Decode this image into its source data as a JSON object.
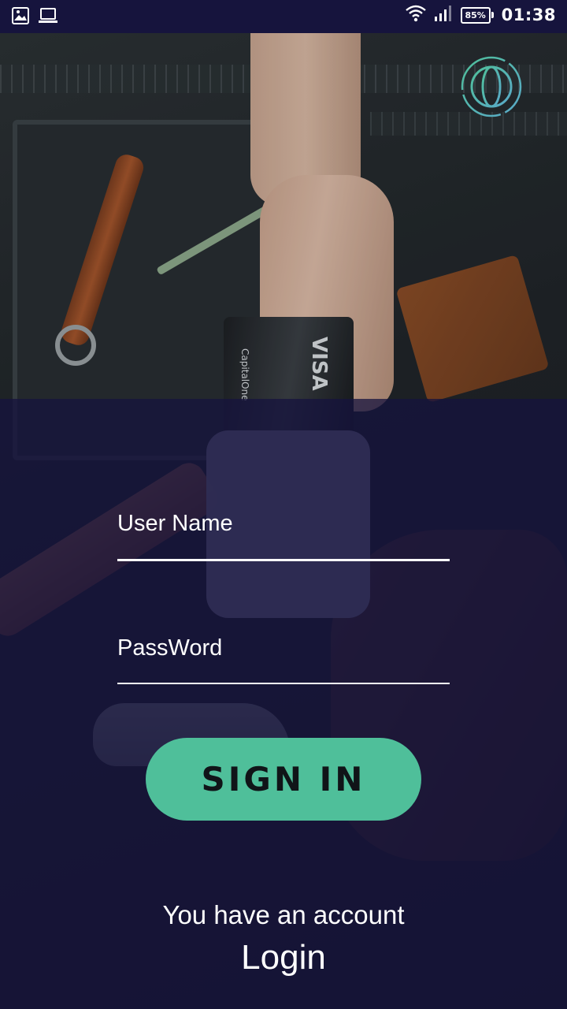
{
  "status_bar": {
    "time": "01:38",
    "battery": "85%",
    "left_icons": [
      "gallery-icon",
      "laptop-icon"
    ],
    "right_icons": [
      "wifi-icon",
      "signal-icon",
      "battery-icon"
    ]
  },
  "language_button": {
    "icon": "globe-icon",
    "accent_color": "#4fbf9a"
  },
  "form": {
    "username_label": "User Name",
    "password_label": "PassWord",
    "username_value": "",
    "password_value": ""
  },
  "sign_in_button": {
    "label": "SIGN IN",
    "color": "#4fbf9a"
  },
  "footer": {
    "account_text": "You have an account",
    "login_label": "Login"
  },
  "background": {
    "card_brand": "CapitalOne",
    "card_network": "VISA",
    "overlay_color": "#14123c"
  }
}
